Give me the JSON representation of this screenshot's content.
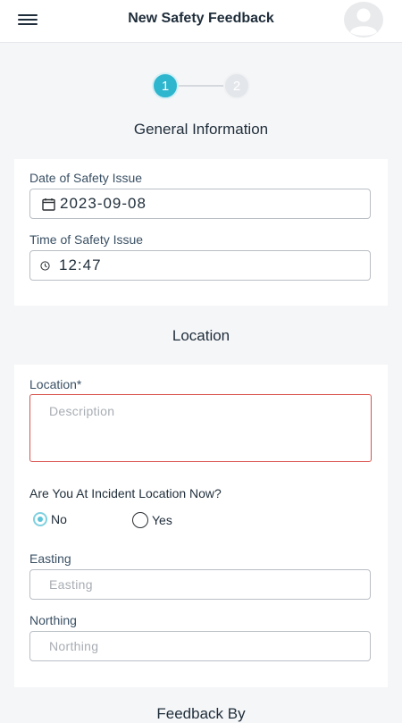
{
  "header": {
    "title": "New Safety Feedback",
    "menu_icon": "hamburger-menu-icon",
    "avatar_icon": "user-avatar-icon"
  },
  "stepper": {
    "steps": [
      "1",
      "2"
    ],
    "active_step": 1
  },
  "general": {
    "section_title": "General Information",
    "date_label": "Date of Safety Issue",
    "date_value": "2023-09-08",
    "time_label": "Time of Safety Issue",
    "time_value": "12:47"
  },
  "location": {
    "section_title": "Location",
    "location_label": "Location*",
    "description_placeholder": "Description",
    "question": "Are You At Incident Location Now?",
    "options": [
      "No",
      "Yes"
    ],
    "selected": "No",
    "easting_label": "Easting",
    "easting_placeholder": "Easting",
    "northing_label": "Northing",
    "northing_placeholder": "Northing"
  },
  "feedback_by": {
    "section_title": "Feedback By"
  },
  "colors": {
    "accent": "#2fb6cf",
    "error_border": "#d9534f",
    "background": "#f5f6f8"
  }
}
